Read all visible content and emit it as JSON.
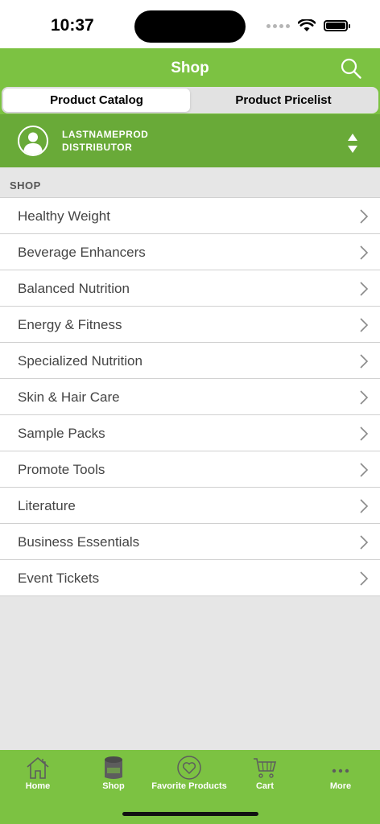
{
  "status_bar": {
    "time": "10:37"
  },
  "nav": {
    "title": "Shop"
  },
  "segments": [
    {
      "label": "Product Catalog",
      "active": true
    },
    {
      "label": "Product Pricelist",
      "active": false
    }
  ],
  "profile": {
    "name": "LASTNAMEPROD",
    "role": "DISTRIBUTOR"
  },
  "section": {
    "title": "SHOP"
  },
  "categories": [
    "Healthy Weight",
    "Beverage Enhancers",
    "Balanced Nutrition",
    "Energy & Fitness",
    "Specialized Nutrition",
    "Skin & Hair Care",
    "Sample Packs",
    "Promote Tools",
    "Literature",
    "Business Essentials",
    "Event Tickets"
  ],
  "tabs": [
    {
      "label": "Home",
      "icon": "home-icon"
    },
    {
      "label": "Shop",
      "icon": "shop-icon"
    },
    {
      "label": "Favorite Products",
      "icon": "heart-icon"
    },
    {
      "label": "Cart",
      "icon": "cart-icon"
    },
    {
      "label": "More",
      "icon": "more-icon"
    }
  ],
  "colors": {
    "brand_green": "#7cc242",
    "profile_green": "#69aa38",
    "background": "#e6e6e6"
  }
}
